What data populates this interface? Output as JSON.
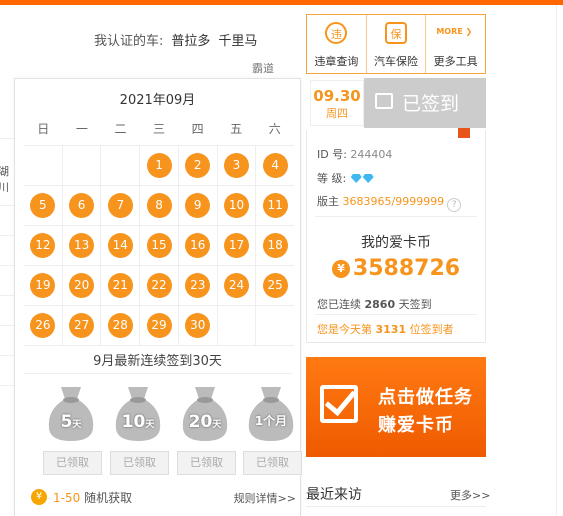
{
  "car": {
    "label": "我认证的车:",
    "cars": [
      "普拉多",
      "千里马"
    ],
    "badao": "霸道"
  },
  "left_fragment": "湖川",
  "calendar": {
    "title": "2021年09月",
    "weekdays": [
      "日",
      "一",
      "二",
      "三",
      "四",
      "五",
      "六"
    ],
    "rows": [
      [
        "",
        "",
        "",
        "1",
        "2",
        "3",
        "4"
      ],
      [
        "5",
        "6",
        "7",
        "8",
        "9",
        "10",
        "11"
      ],
      [
        "12",
        "13",
        "14",
        "15",
        "16",
        "17",
        "18"
      ],
      [
        "19",
        "20",
        "21",
        "22",
        "23",
        "24",
        "25"
      ],
      [
        "26",
        "27",
        "28",
        "29",
        "30",
        "",
        ""
      ]
    ],
    "month_note": "9月最新连续签到30天",
    "rewards": [
      {
        "big": "5",
        "small": "天",
        "status": "已领取"
      },
      {
        "big": "10",
        "small": "天",
        "status": "已领取"
      },
      {
        "big": "20",
        "small": "天",
        "status": "已领取"
      },
      {
        "big": "1个月",
        "small": "",
        "status": "已领取"
      }
    ],
    "coin_symbol": "¥",
    "random_range": "1-50",
    "random_text": "随机获取",
    "rules": "规则详情>>"
  },
  "tools": [
    {
      "label": "违章查询",
      "icon": "违",
      "icon_name": "violation-icon"
    },
    {
      "label": "汽车保险",
      "icon": "保",
      "icon_name": "insurance-icon"
    },
    {
      "label": "更多工具",
      "icon": "MORE",
      "icon_name": "more-icon"
    }
  ],
  "sign": {
    "date": "09.30",
    "weekday": "周四",
    "status": "已签到"
  },
  "profile": {
    "id_label": "ID 号:",
    "id": "244404",
    "level_label": "等  级:",
    "owner_label": "版主",
    "owner_value": "3683965/9999999",
    "coin_title": "我的爱卡币",
    "coin_symbol": "¥",
    "coins": "3588726",
    "streak_prefix": "您已连续",
    "streak_days": "2860",
    "streak_suffix": "天签到",
    "today_prefix": "您是今天第",
    "today_rank": "3131",
    "today_suffix": "位签到者"
  },
  "task_banner": {
    "line1": "点击做任务",
    "line2": "赚爱卡币"
  },
  "recent": {
    "title": "最近来访",
    "more": "更多>>"
  },
  "colors": {
    "accent": "#f7941d",
    "bar": "#ff6600",
    "signed_bg": "#cccccc"
  }
}
